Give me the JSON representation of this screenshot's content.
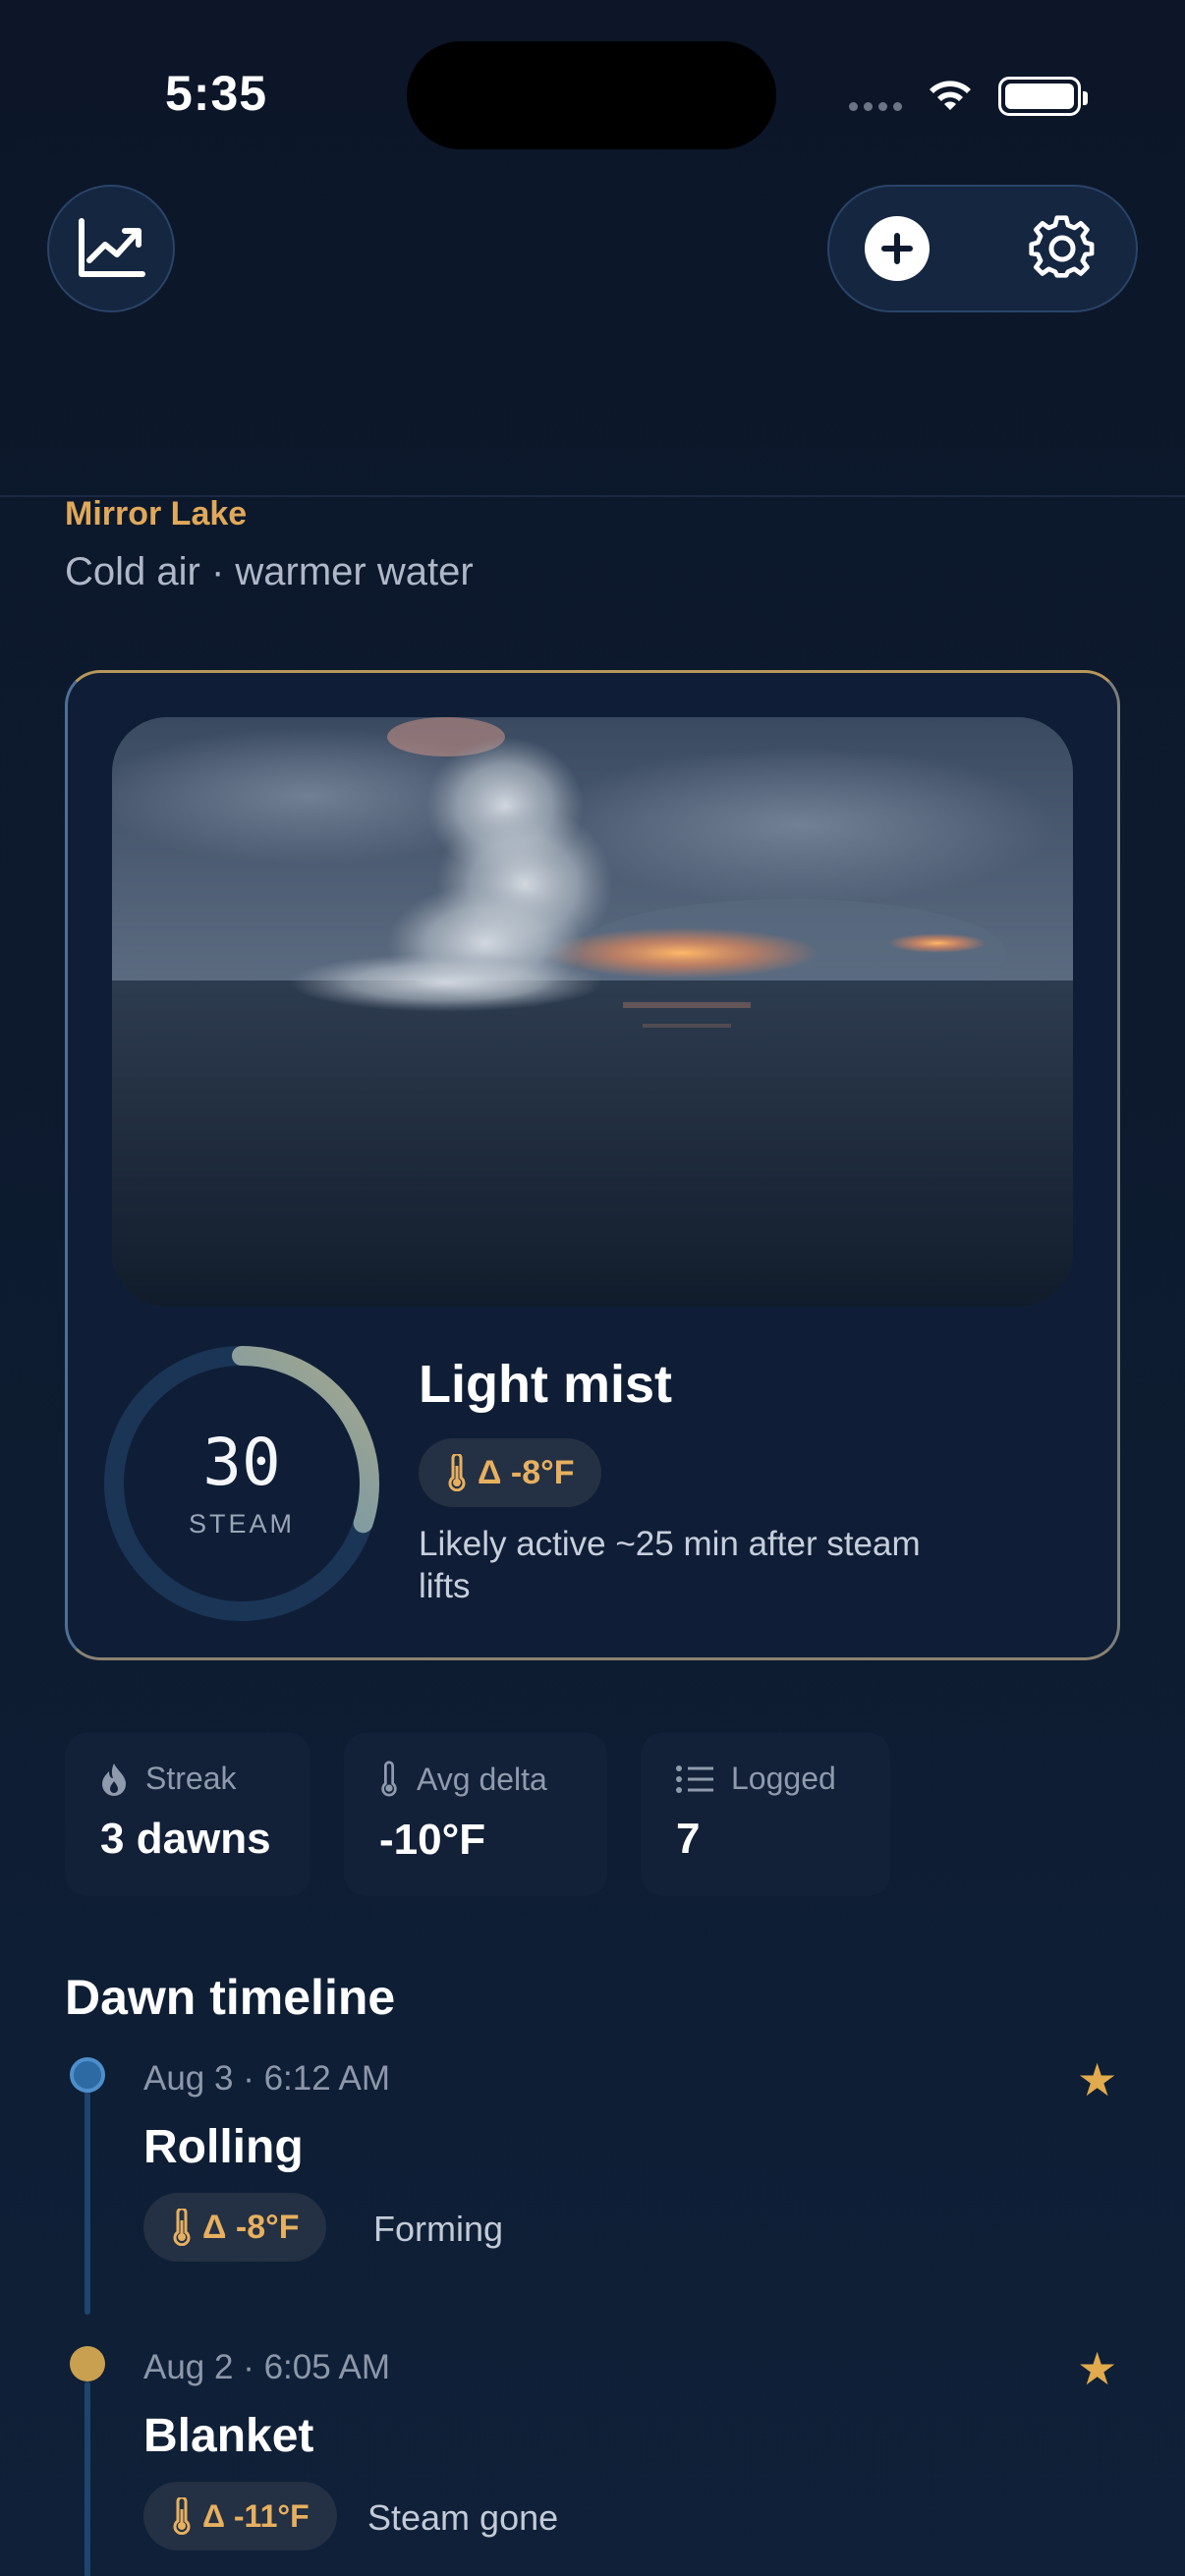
{
  "status_bar": {
    "time": "5:35"
  },
  "location": {
    "name": "Mirror Lake",
    "subtitle": "Cold air · warmer water"
  },
  "current": {
    "steam_score": "30",
    "steam_label": "STEAM",
    "steam_fraction": 0.3,
    "title": "Light mist",
    "delta": "Δ -8°F",
    "description": "Likely active ~25 min after steam lifts"
  },
  "stats": [
    {
      "label": "Streak",
      "value": "3 dawns",
      "icon": "flame-icon"
    },
    {
      "label": "Avg delta",
      "value": "-10°F",
      "icon": "thermometer-icon"
    },
    {
      "label": "Logged",
      "value": "7",
      "icon": "list-icon"
    }
  ],
  "timeline": {
    "title": "Dawn timeline",
    "entries": [
      {
        "date": "Aug 3 · 6:12 AM",
        "title": "Rolling",
        "delta": "Δ -8°F",
        "note": "Forming",
        "favorite": true,
        "dot_color": "#3a78b0"
      },
      {
        "date": "Aug 2 · 6:05 AM",
        "title": "Blanket",
        "delta": "Δ -11°F",
        "note": "Steam gone",
        "favorite": true,
        "dot_color": "#c9a050"
      }
    ]
  },
  "colors": {
    "accent": "#e0a85a",
    "background": "#0c1628",
    "ring_start": "#3b82c4",
    "ring_end": "#a8a98c"
  }
}
